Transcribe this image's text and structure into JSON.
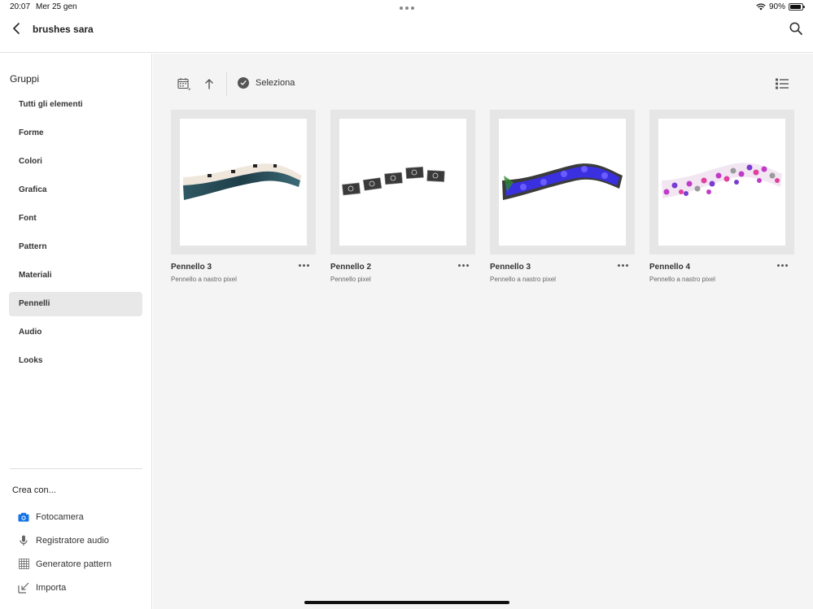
{
  "status_bar": {
    "time": "20:07",
    "date": "Mer 25 gen",
    "battery": "90%"
  },
  "header": {
    "title": "brushes sara"
  },
  "sidebar": {
    "groups_title": "Gruppi",
    "items": [
      {
        "label": "Tutti gli elementi"
      },
      {
        "label": "Forme"
      },
      {
        "label": "Colori"
      },
      {
        "label": "Grafica"
      },
      {
        "label": "Font"
      },
      {
        "label": "Pattern"
      },
      {
        "label": "Materiali"
      },
      {
        "label": "Pennelli",
        "active": true
      },
      {
        "label": "Audio"
      },
      {
        "label": "Looks"
      }
    ],
    "create_title": "Crea con...",
    "create_items": [
      {
        "label": "Fotocamera",
        "icon": "camera-icon"
      },
      {
        "label": "Registratore audio",
        "icon": "microphone-icon"
      },
      {
        "label": "Generatore pattern",
        "icon": "pattern-grid-icon"
      },
      {
        "label": "Importa",
        "icon": "import-icon"
      }
    ]
  },
  "toolbar": {
    "select_label": "Seleziona"
  },
  "cards": [
    {
      "name": "Pennello 3",
      "subtitle": "Pennello a nastro pixel"
    },
    {
      "name": "Pennello 2",
      "subtitle": "Pennello pixel"
    },
    {
      "name": "Pennello 3",
      "subtitle": "Pennello a nastro pixel"
    },
    {
      "name": "Pennello 4",
      "subtitle": "Pennello a nastro pixel"
    }
  ],
  "colors": {
    "active_bg": "#e8e8e8",
    "main_bg": "#f4f4f4",
    "camera_blue": "#1473e6"
  }
}
